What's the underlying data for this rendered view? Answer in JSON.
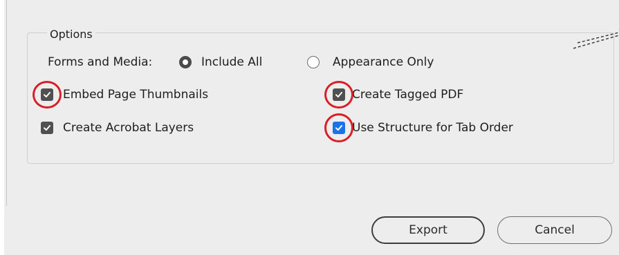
{
  "options": {
    "legend": "Options",
    "forms_media_label": "Forms and Media:",
    "forms_media_options": [
      {
        "label": "Include All",
        "selected": true
      },
      {
        "label": "Appearance Only",
        "selected": false
      }
    ],
    "checkboxes": {
      "embed_thumbnails": {
        "label": "Embed Page Thumbnails",
        "checked": true,
        "highlighted": true
      },
      "acrobat_layers": {
        "label": "Create Acrobat Layers",
        "checked": true,
        "highlighted": false
      },
      "tagged_pdf": {
        "label": "Create Tagged PDF",
        "checked": true,
        "highlighted": true
      },
      "tab_order": {
        "label": "Use Structure for Tab Order",
        "checked": true,
        "highlighted": true
      }
    }
  },
  "buttons": {
    "export": "Export",
    "cancel": "Cancel"
  },
  "colors": {
    "dialog_bg": "#ededed",
    "checkbox_gray": "#505050",
    "checkbox_blue": "#1a73e8",
    "highlight_red": "#d91f26"
  }
}
